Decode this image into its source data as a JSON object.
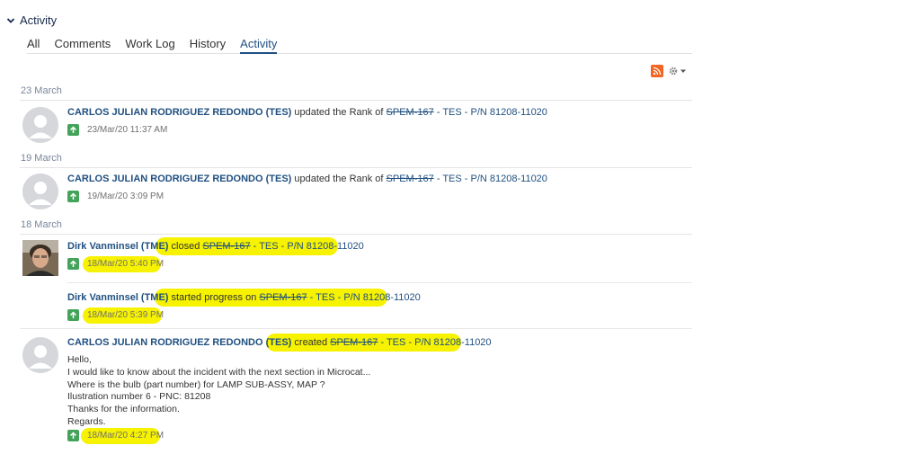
{
  "section": {
    "title": "Activity"
  },
  "tabs": [
    {
      "label": "All",
      "active": false
    },
    {
      "label": "Comments",
      "active": false
    },
    {
      "label": "Work Log",
      "active": false
    },
    {
      "label": "History",
      "active": false
    },
    {
      "label": "Activity",
      "active": true
    }
  ],
  "feed_tools": {
    "rss_icon": "rss-icon",
    "settings_icon": "gear-icon"
  },
  "groups": [
    {
      "date": "23 March",
      "entries": [
        {
          "user": "CARLOS JULIAN RODRIGUEZ REDONDO (TES)",
          "action": "updated the Rank of",
          "issue_key": "SPEM-167",
          "issue_summary": "- TES - P/N 81208-11020",
          "timestamp": "23/Mar/20 11:37 AM"
        }
      ]
    },
    {
      "date": "19 March",
      "entries": [
        {
          "user": "CARLOS JULIAN RODRIGUEZ REDONDO (TES)",
          "action": "updated the Rank of",
          "issue_key": "SPEM-167",
          "issue_summary": "- TES - P/N 81208-11020",
          "timestamp": "19/Mar/20 3:09 PM"
        }
      ]
    },
    {
      "date": "18 March",
      "entries": [
        {
          "user": "Dirk Vanminsel (TME)",
          "action": "closed",
          "issue_key": "SPEM-167",
          "issue_summary": "- TES - P/N 81208-11020",
          "timestamp": "18/Mar/20 5:40 PM"
        },
        {
          "user": "Dirk Vanminsel (TME)",
          "action": "started progress on",
          "issue_key": "SPEM-167",
          "issue_summary": "- TES - P/N 81208-11020",
          "timestamp": "18/Mar/20 5:39 PM"
        },
        {
          "user": "CARLOS JULIAN RODRIGUEZ REDONDO (TES)",
          "action": "created",
          "issue_key": "SPEM-167",
          "issue_summary": "- TES - P/N 81208-11020",
          "timestamp": "18/Mar/20 4:27 PM",
          "body": [
            "Hello,",
            "I would like to know about the incident with the next section in Microcat...",
            "Where is the bulb (part number) for LAMP SUB-ASSY, MAP ?",
            "Ilustration number 6 - PNC: 81208",
            "Thanks for the information.",
            "Regards."
          ]
        }
      ]
    }
  ],
  "colors": {
    "link": "#205081",
    "highlight": "#f6f200",
    "action_icon": "#44a35a",
    "rss": "#f26522"
  }
}
